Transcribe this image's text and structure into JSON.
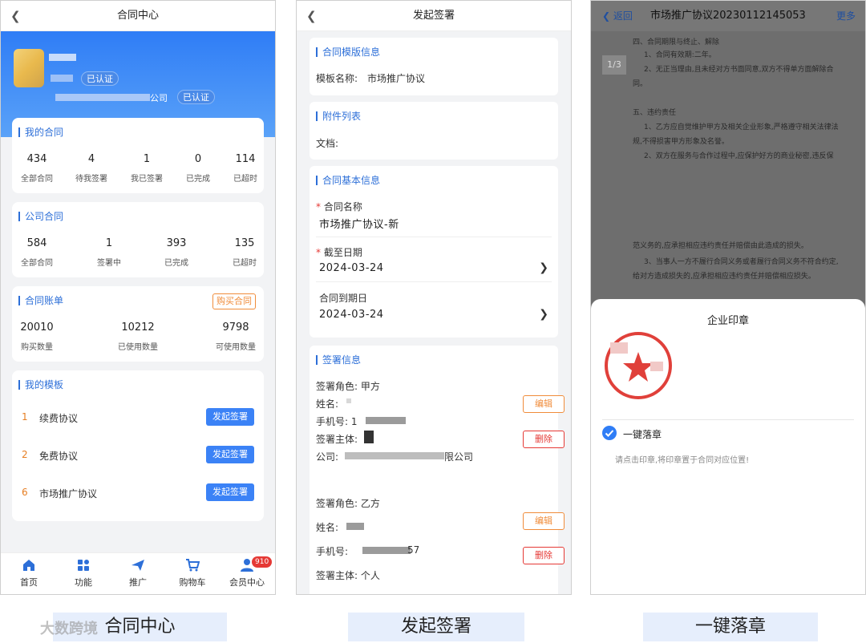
{
  "screen1": {
    "title": "合同中心",
    "verified_badge": "已认证",
    "company_suffix": "公司",
    "company_verified": "已认证",
    "my_contracts": {
      "title": "我的合同",
      "stats": [
        {
          "value": "434",
          "label": "全部合同"
        },
        {
          "value": "4",
          "label": "待我签署"
        },
        {
          "value": "1",
          "label": "我已签署"
        },
        {
          "value": "0",
          "label": "已完成"
        },
        {
          "value": "114",
          "label": "已超时"
        }
      ]
    },
    "company_contracts": {
      "title": "公司合同",
      "stats": [
        {
          "value": "584",
          "label": "全部合同"
        },
        {
          "value": "1",
          "label": "签署中"
        },
        {
          "value": "393",
          "label": "已完成"
        },
        {
          "value": "135",
          "label": "已超时"
        }
      ]
    },
    "bill": {
      "title": "合同账单",
      "buy_button": "购买合同",
      "stats": [
        {
          "value": "20010",
          "label": "购买数量"
        },
        {
          "value": "10212",
          "label": "已使用数量"
        },
        {
          "value": "9798",
          "label": "可使用数量"
        }
      ]
    },
    "templates": {
      "title": "我的模板",
      "items": [
        {
          "num": "1",
          "name": "续费协议",
          "button": "发起签署"
        },
        {
          "num": "2",
          "name": "免费协议",
          "button": "发起签署"
        },
        {
          "num": "6",
          "name": "市场推广协议",
          "button": "发起签署"
        }
      ]
    },
    "tabbar": [
      {
        "label": "首页",
        "icon": "home-icon"
      },
      {
        "label": "功能",
        "icon": "grid-icon"
      },
      {
        "label": "推广",
        "icon": "paper-plane-icon"
      },
      {
        "label": "购物车",
        "icon": "cart-icon"
      },
      {
        "label": "会员中心",
        "icon": "user-icon",
        "badge": "910"
      }
    ],
    "caption": "合同中心"
  },
  "screen2": {
    "title": "发起签署",
    "template_section": {
      "title": "合同模版信息",
      "label": "模板名称:",
      "value": "市场推广协议"
    },
    "attachment_section": {
      "title": "附件列表",
      "label": "文档:"
    },
    "basic_section": {
      "title": "合同基本信息",
      "name_label": "合同名称",
      "name_value": "市场推广协议-新",
      "deadline_label": "截至日期",
      "deadline_value": "2024-03-24",
      "expire_label": "合同到期日",
      "expire_value": "2024-03-24"
    },
    "sign_section": {
      "title": "签署信息",
      "party_a": {
        "role": "签署角色: 甲方",
        "name": "姓名:",
        "phone": "手机号: 1",
        "subject": "签署主体:",
        "company": "公司:",
        "company_suffix": "限公司",
        "edit": "编辑",
        "delete": "删除"
      },
      "party_b": {
        "role": "签署角色: 乙方",
        "name": "姓名:",
        "phone": "手机号:",
        "phone_suffix": "57",
        "subject": "签署主体: 个人",
        "edit": "编辑",
        "delete": "删除"
      }
    },
    "caption": "发起签署"
  },
  "screen3": {
    "back": "返回",
    "title": "市场推广协议20230112145053",
    "more": "更多",
    "page_indicator": "1/3",
    "doc_lines": [
      "四、合同期限与终止、解除",
      "1、合同有效期:二年。",
      "2、无正当理由,且未经对方书面同意,双方不得单方面解除合",
      "同。",
      "五、违约责任",
      "1、乙方应自觉维护甲方及相关企业形象,严格遵守相关法律法",
      "规,不得损害甲方形象及名誉。",
      "2、双方在服务与合作过程中,应保护好方的商业秘密,违反保",
      "范义务的,应承担相应违约责任并赔偿由此造成的损失。",
      "3、当事人一方不履行合同义务或者履行合同义务不符合约定,",
      "给对方造成损失的,应承担相应违约责任并赔偿相应损失。"
    ],
    "seal_panel_title": "企业印章",
    "one_click_label": "一键落章",
    "hint": "请点击印章,将印章置于合同对应位置!",
    "caption": "一键落章"
  },
  "watermark": "大数跨境"
}
